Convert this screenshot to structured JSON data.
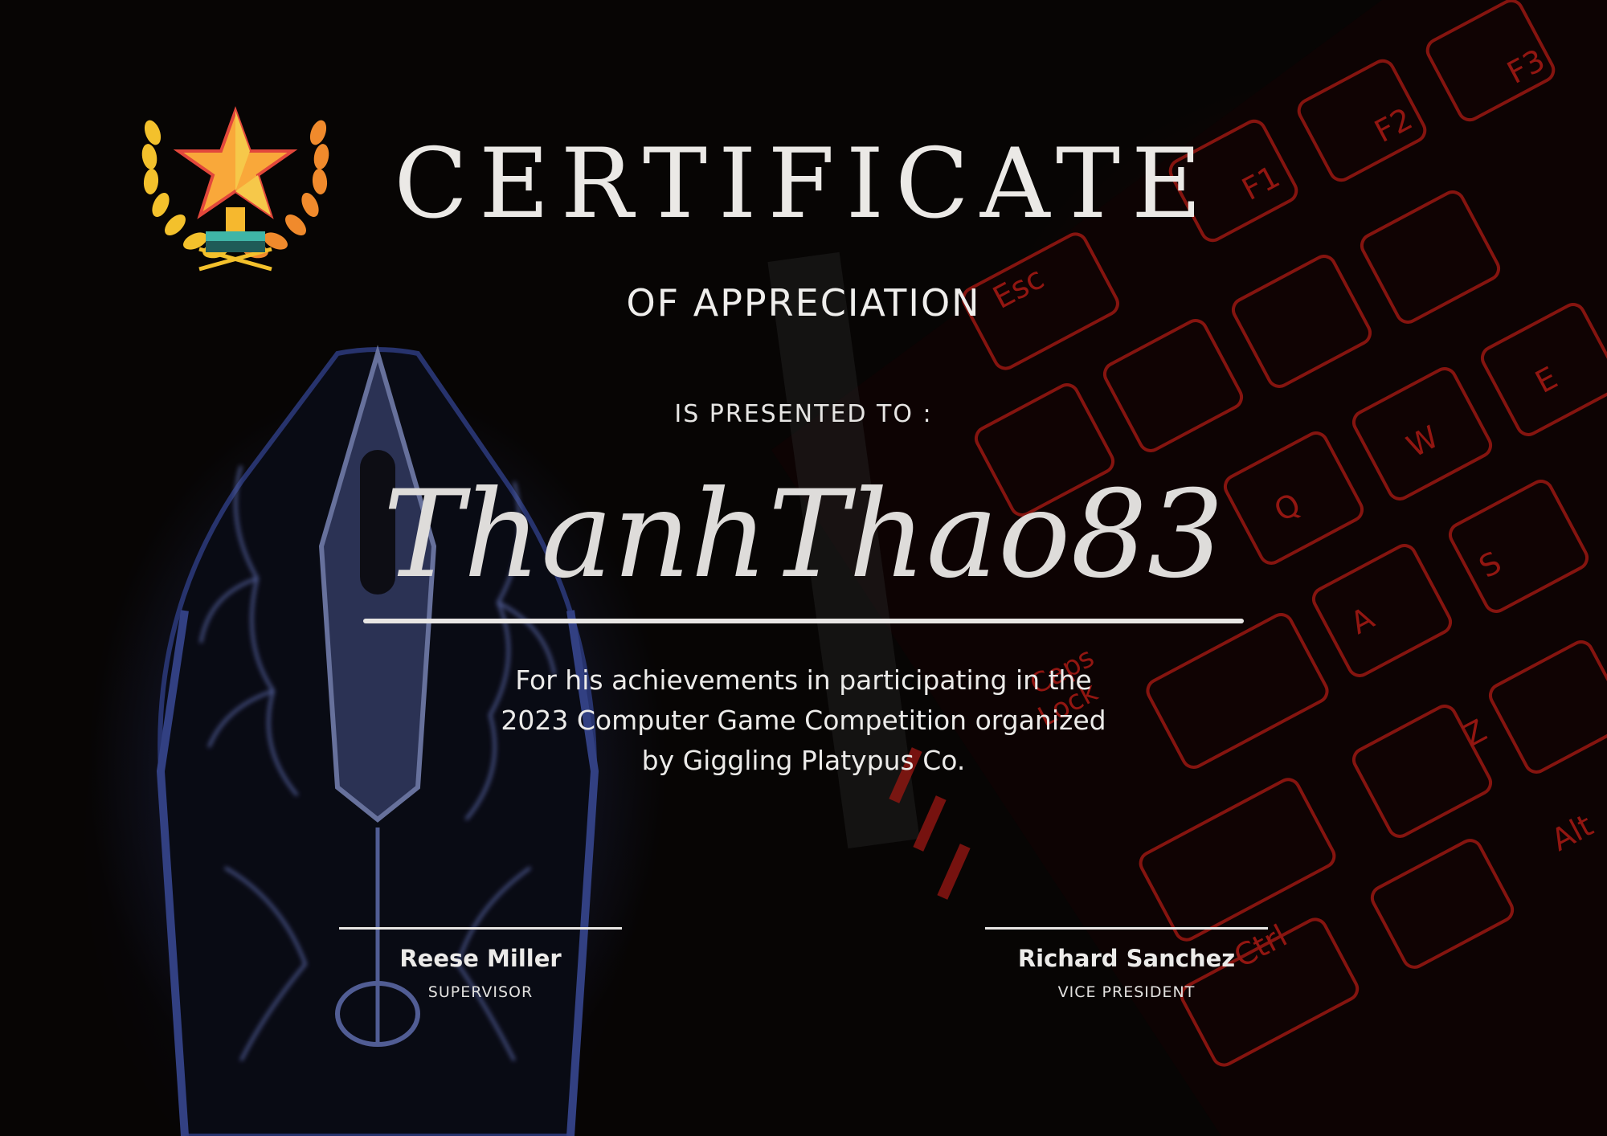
{
  "certificate": {
    "title": "CERTIFICATE",
    "subtitle": "OF APPRECIATION",
    "presented_label": "IS PRESENTED TO :",
    "recipient": "ThanhThao83",
    "description_lines": [
      "For his achievements in participating in the",
      "2023 Computer Game Competition organized",
      "by Giggling Platypus Co."
    ]
  },
  "signatories": [
    {
      "name": "Reese Miller",
      "role": "SUPERVISOR"
    },
    {
      "name": "Richard Sanchez",
      "role": "VICE PRESIDENT"
    }
  ],
  "logo": {
    "icon": "star-trophy-laurel-icon"
  },
  "background": {
    "left_art": "gaming-mouse-blue-glow",
    "right_art": "keyboard-red-backlight",
    "keycaps": [
      "F1",
      "F2",
      "F3",
      "Esc",
      "Caps Lock",
      "Ctrl",
      "Alt",
      "Q",
      "W",
      "E",
      "A",
      "S",
      "Z"
    ]
  },
  "colors": {
    "background": "#0b0807",
    "text": "#ebe9e6",
    "keyboard_glow": "#e0231b",
    "mouse_glow": "#6f86e8",
    "logo_gold": "#f6b82e"
  }
}
